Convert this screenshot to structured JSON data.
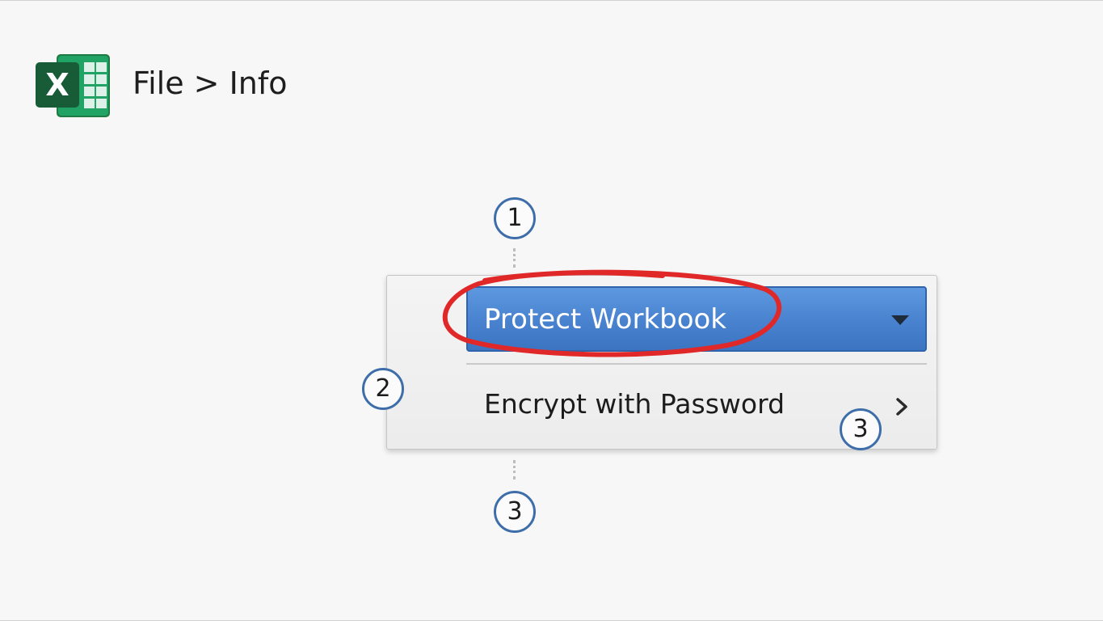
{
  "header": {
    "app_icon": "excel-icon",
    "logo_letter": "X",
    "title": "File > Info"
  },
  "menu": {
    "protect_workbook_label": "Protect Workbook",
    "protect_workbook_icon": "caret-down-icon",
    "encrypt_label": "Encrypt with Password",
    "encrypt_icon": "chevron-right-icon"
  },
  "steps": {
    "step_1": "1",
    "step_2": "2",
    "step_3_menu": "3",
    "step_3_bottom": "3"
  },
  "colors": {
    "accent_blue": "#4a84d1",
    "highlight_red": "#e02828",
    "step_ring": "#3e6ea9",
    "excel_green": "#1f7a45"
  }
}
